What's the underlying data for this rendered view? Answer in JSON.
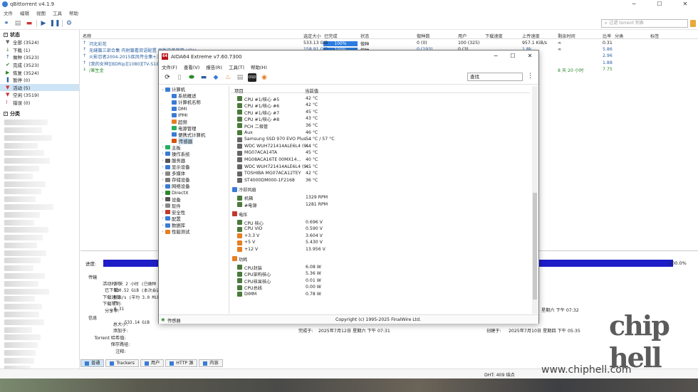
{
  "qbit": {
    "title": "qBittorrent v4.1.9",
    "menu": [
      "文件",
      "编辑",
      "视图",
      "工具",
      "帮助"
    ],
    "search_placeholder": "过滤 torrent 列表",
    "sidebar": {
      "status_header": "状态",
      "status_items": [
        {
          "label": "全部 (3524)",
          "icon": "filter-icon",
          "color": "#666"
        },
        {
          "label": "下载 (1)",
          "icon": "download-icon",
          "color": "#2a8a2a"
        },
        {
          "label": "做种 (3523)",
          "icon": "upload-icon",
          "color": "#2a5fa0"
        },
        {
          "label": "完成 (3523)",
          "icon": "check-icon",
          "color": "#2a8a2a"
        },
        {
          "label": "恢复 (3524)",
          "icon": "resume-icon",
          "color": "#2a8a2a"
        },
        {
          "label": "暂停 (0)",
          "icon": "pause-icon",
          "color": "#2a5fa0"
        },
        {
          "label": "活动 (5)",
          "icon": "filter-icon",
          "color": "#c33"
        },
        {
          "label": "空闲 (3519)",
          "icon": "filter-icon",
          "color": "#c33"
        },
        {
          "label": "错误 (0)",
          "icon": "error-icon",
          "color": "#c33"
        }
      ],
      "category_header": "分类"
    },
    "columns": [
      "名称",
      "选定大小",
      "已完成",
      "状态",
      "做种数",
      "用户",
      "下载速度",
      "上传速度",
      "剩余时间",
      "比率",
      "分类",
      "标签"
    ],
    "rows": [
      {
        "name": "河北彩花",
        "size": "533.13 GiB",
        "progress": "100%",
        "status": "做种",
        "seeds": "0 (0)",
        "peers": "100 (325)",
        "up": "957.1 KiB/s",
        "eta": "∞",
        "ratio": "0.31",
        "dl": false
      },
      {
        "name": "无缝篇三部合集 内射篇看双语配置 更新中英字幕-HDH",
        "size": "158.91 GiB",
        "progress": "100%",
        "status": "做种",
        "seeds": "0 (193)",
        "peers": "0 (3)",
        "up": "1.8k",
        "eta": "∞",
        "ratio": "5.86",
        "dl": false
      },
      {
        "name": "火影忍者2004-2015疾风传全集+三",
        "size": "",
        "progress": "",
        "status": "",
        "seeds": "",
        "peers": "",
        "up": "",
        "eta": "",
        "ratio": "2.96",
        "dl": false
      },
      {
        "name": "[我的女神][BDRip][1080][TV-S1&S",
        "size": "",
        "progress": "",
        "status": "",
        "seeds": "",
        "peers": "",
        "up": "",
        "eta": "",
        "ratio": "1.88",
        "dl": false
      },
      {
        "name": "/果生金",
        "size": "",
        "progress": "",
        "status": "",
        "seeds": "",
        "peers": "",
        "up": "",
        "eta": "8 天 20 小时",
        "ratio": "7.75",
        "dl": true
      }
    ],
    "bottom": {
      "progress_label": "进度:",
      "progress_pct": "100.0%",
      "transfer_header": "传输",
      "info_header": "信息",
      "lines": [
        {
          "k": "活动时间:",
          "v": "2 天 2 小时 (已做种 4"
        },
        {
          "k": "已下载:",
          "v": "530.52 GiB (本次会话"
        },
        {
          "k": "下载速度:",
          "v": "0 B/s (平均 3.0 MiB"
        },
        {
          "k": "下载限制:",
          "v": "∞"
        },
        {
          "k": "分享率:",
          "v": "0.31"
        }
      ],
      "info_lines": [
        {
          "k": "总大小:",
          "v": "533.14 GiB"
        },
        {
          "k": "添加于:",
          "v": ""
        },
        {
          "k": "Torrent 哈希值:",
          "v": ""
        },
        {
          "k": "保存路径:",
          "v": ""
        },
        {
          "k": "注释:",
          "v": ""
        }
      ],
      "completed_label": "完成于:",
      "completed_value": "2025年7月12日 星期六 下午 07:31",
      "created_label": "创建于:",
      "created_value": "2025年7月10日 星期四 下午 05:35",
      "right_date": "星期六 下午 07:32",
      "tabs": [
        "普通",
        "Trackers",
        "用户",
        "HTTP 源",
        "内容"
      ]
    },
    "statusbar": {
      "dht": "DHT: 409 结点"
    }
  },
  "aida": {
    "title": "AIDA64 Extreme v7.60.7300",
    "logo_text": "64",
    "menu": [
      "文件(F)",
      "查看(V)",
      "报告(R)",
      "工具(T)",
      "帮助(H)"
    ],
    "search_value": "查找",
    "col_item": "项目",
    "col_value": "当前值",
    "tree": [
      {
        "label": "计算机",
        "level": 0,
        "open": true,
        "color": "#3a7bd5"
      },
      {
        "label": "系统概述",
        "level": 1,
        "color": "#3a7bd5"
      },
      {
        "label": "计算机名称",
        "level": 1,
        "color": "#3a7bd5"
      },
      {
        "label": "DMI",
        "level": 1,
        "color": "#3a7bd5"
      },
      {
        "label": "IPMI",
        "level": 1,
        "color": "#3a7bd5"
      },
      {
        "label": "超频",
        "level": 1,
        "color": "#e67e22"
      },
      {
        "label": "电源管理",
        "level": 1,
        "color": "#27ae60"
      },
      {
        "label": "便携式计算机",
        "level": 1,
        "color": "#3a7bd5"
      },
      {
        "label": "传感器",
        "level": 1,
        "color": "#d35400",
        "sel": true
      },
      {
        "label": "主板",
        "level": 0,
        "color": "#27ae60"
      },
      {
        "label": "操作系统",
        "level": 0,
        "color": "#3a7bd5"
      },
      {
        "label": "服务器",
        "level": 0,
        "color": "#555"
      },
      {
        "label": "显示设备",
        "level": 0,
        "color": "#3a7bd5"
      },
      {
        "label": "多媒体",
        "level": 0,
        "color": "#888"
      },
      {
        "label": "存储设备",
        "level": 0,
        "color": "#777"
      },
      {
        "label": "网络设备",
        "level": 0,
        "color": "#3a7bd5"
      },
      {
        "label": "DirectX",
        "level": 0,
        "color": "#2a8a2a"
      },
      {
        "label": "设备",
        "level": 0,
        "color": "#555"
      },
      {
        "label": "软件",
        "level": 0,
        "color": "#888"
      },
      {
        "label": "安全性",
        "level": 0,
        "color": "#c0392b"
      },
      {
        "label": "配置",
        "level": 0,
        "color": "#3a7bd5"
      },
      {
        "label": "数据库",
        "level": 0,
        "color": "#3a7bd5"
      },
      {
        "label": "性能测试",
        "level": 0,
        "color": "#e67e22"
      }
    ],
    "rows": [
      {
        "k": "CPU #1/核心 #5",
        "v": "42 °C",
        "ic": "#4a7a3a"
      },
      {
        "k": "CPU #1/核心 #6",
        "v": "42 °C",
        "ic": "#4a7a3a"
      },
      {
        "k": "CPU #1/核心 #7",
        "v": "45 °C",
        "ic": "#4a7a3a"
      },
      {
        "k": "CPU #1/核心 #8",
        "v": "43 °C",
        "ic": "#4a7a3a"
      },
      {
        "k": "PCH 二极管",
        "v": "36 °C",
        "ic": "#4a7a3a"
      },
      {
        "k": "Aux",
        "v": "46 °C",
        "ic": "#4a7a3a"
      },
      {
        "k": "Samsung SSD 970 EVO Plus ...",
        "v": "54 °C / 57 °C",
        "ic": "#666"
      },
      {
        "k": "WDC  WUH721414ALE6L4 (9...",
        "v": "44 °C",
        "ic": "#666"
      },
      {
        "k": "MG07ACA14TA",
        "v": "45 °C",
        "ic": "#666"
      },
      {
        "k": "MG08ACA16TE      00MX14...",
        "v": "40 °C",
        "ic": "#666"
      },
      {
        "k": "WDC  WUH721414ALE6L4 (9...",
        "v": "45 °C",
        "ic": "#666"
      },
      {
        "k": "TOSHIBA MG07ACA12TEY",
        "v": "42 °C",
        "ic": "#666"
      },
      {
        "k": "ST4000DM000-1F2168",
        "v": "36 °C",
        "ic": "#666"
      },
      {
        "section": "冷却风扇",
        "ic": "#3a7bd5"
      },
      {
        "k": "机箱",
        "v": "1329 RPM",
        "ic": "#4a7a3a"
      },
      {
        "k": "#电源",
        "v": "1281 RPM",
        "ic": "#4a7a3a"
      },
      {
        "section": "电压",
        "ic": "#c0392b"
      },
      {
        "k": "CPU 核心",
        "v": "0.696 V",
        "ic": "#4a7a3a"
      },
      {
        "k": "CPU VID",
        "v": "0.590 V",
        "ic": "#4a7a3a"
      },
      {
        "k": "+3.3 V",
        "v": "3.604 V",
        "ic": "#e67e22"
      },
      {
        "k": "+5 V",
        "v": "5.430 V",
        "ic": "#e67e22"
      },
      {
        "k": "+12 V",
        "v": "13.956 V",
        "ic": "#e67e22"
      },
      {
        "section": "功耗",
        "ic": "#e67e22"
      },
      {
        "k": "CPU封装",
        "v": "6.08 W",
        "ic": "#4a7a3a"
      },
      {
        "k": "CPU架构核心",
        "v": "5.36 W",
        "ic": "#4a7a3a"
      },
      {
        "k": "CPU核显核心",
        "v": "0.01 W",
        "ic": "#4a7a3a"
      },
      {
        "k": "CPU总线",
        "v": "0.00 W",
        "ic": "#4a7a3a"
      },
      {
        "k": "DIMM",
        "v": "0.78 W",
        "ic": "#4a7a3a"
      }
    ],
    "status_left": "传感器",
    "status_center": "Copyright (c) 1995-2025 FinalWire Ltd."
  },
  "watermark": {
    "text": "chip hell",
    "url": "www.chiphell.com"
  }
}
